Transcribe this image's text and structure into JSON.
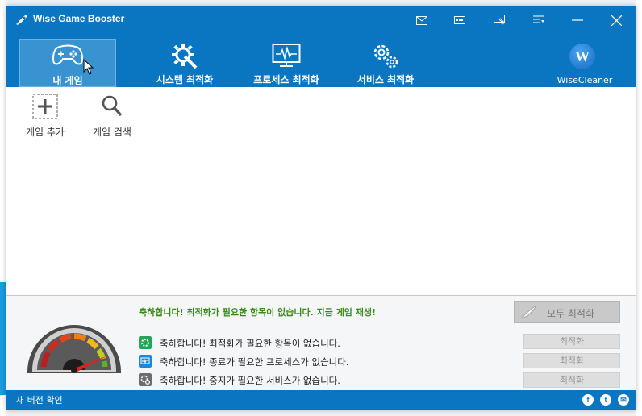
{
  "app": {
    "title": "Wise Game Booster"
  },
  "titlebar": {
    "icons": [
      "mail-icon",
      "chat-icon",
      "feedback-icon",
      "menu-icon",
      "minimize-icon",
      "close-icon"
    ]
  },
  "nav": {
    "tabs": [
      {
        "label": "내 게임",
        "icon": "gamepad-icon",
        "active": true
      },
      {
        "label": "시스템 최적화",
        "icon": "gear-wrench-icon",
        "active": false
      },
      {
        "label": "프로세스 최적화",
        "icon": "monitor-pulse-icon",
        "active": false
      },
      {
        "label": "서비스 최적화",
        "icon": "gears-icon",
        "active": false
      }
    ],
    "brand": "WiseCleaner"
  },
  "toolbar": {
    "add_game": "게임 추가",
    "search_game": "게임 검색"
  },
  "bottom": {
    "headline": "축하합니다! 최적화가 필요한 항목이 없습니다. 지금 게임 재생!",
    "optimize_all": "모두 최적화",
    "rows": [
      {
        "text": "축하합니다! 최적화가 필요한 항목이 없습니다.",
        "button": "최적화",
        "icon": "system-icon"
      },
      {
        "text": "축하합니다! 종료가 필요한 프로세스가 없습니다.",
        "button": "최적화",
        "icon": "process-icon"
      },
      {
        "text": "축하합니다! 중지가 필요한 서비스가 없습니다.",
        "button": "최적화",
        "icon": "service-icon"
      }
    ]
  },
  "statusbar": {
    "check_version": "새 버전 확인",
    "social": [
      "f",
      "t",
      "✉"
    ]
  },
  "colors": {
    "primary": "#0a76c2",
    "success_text": "#3a8a1a"
  }
}
